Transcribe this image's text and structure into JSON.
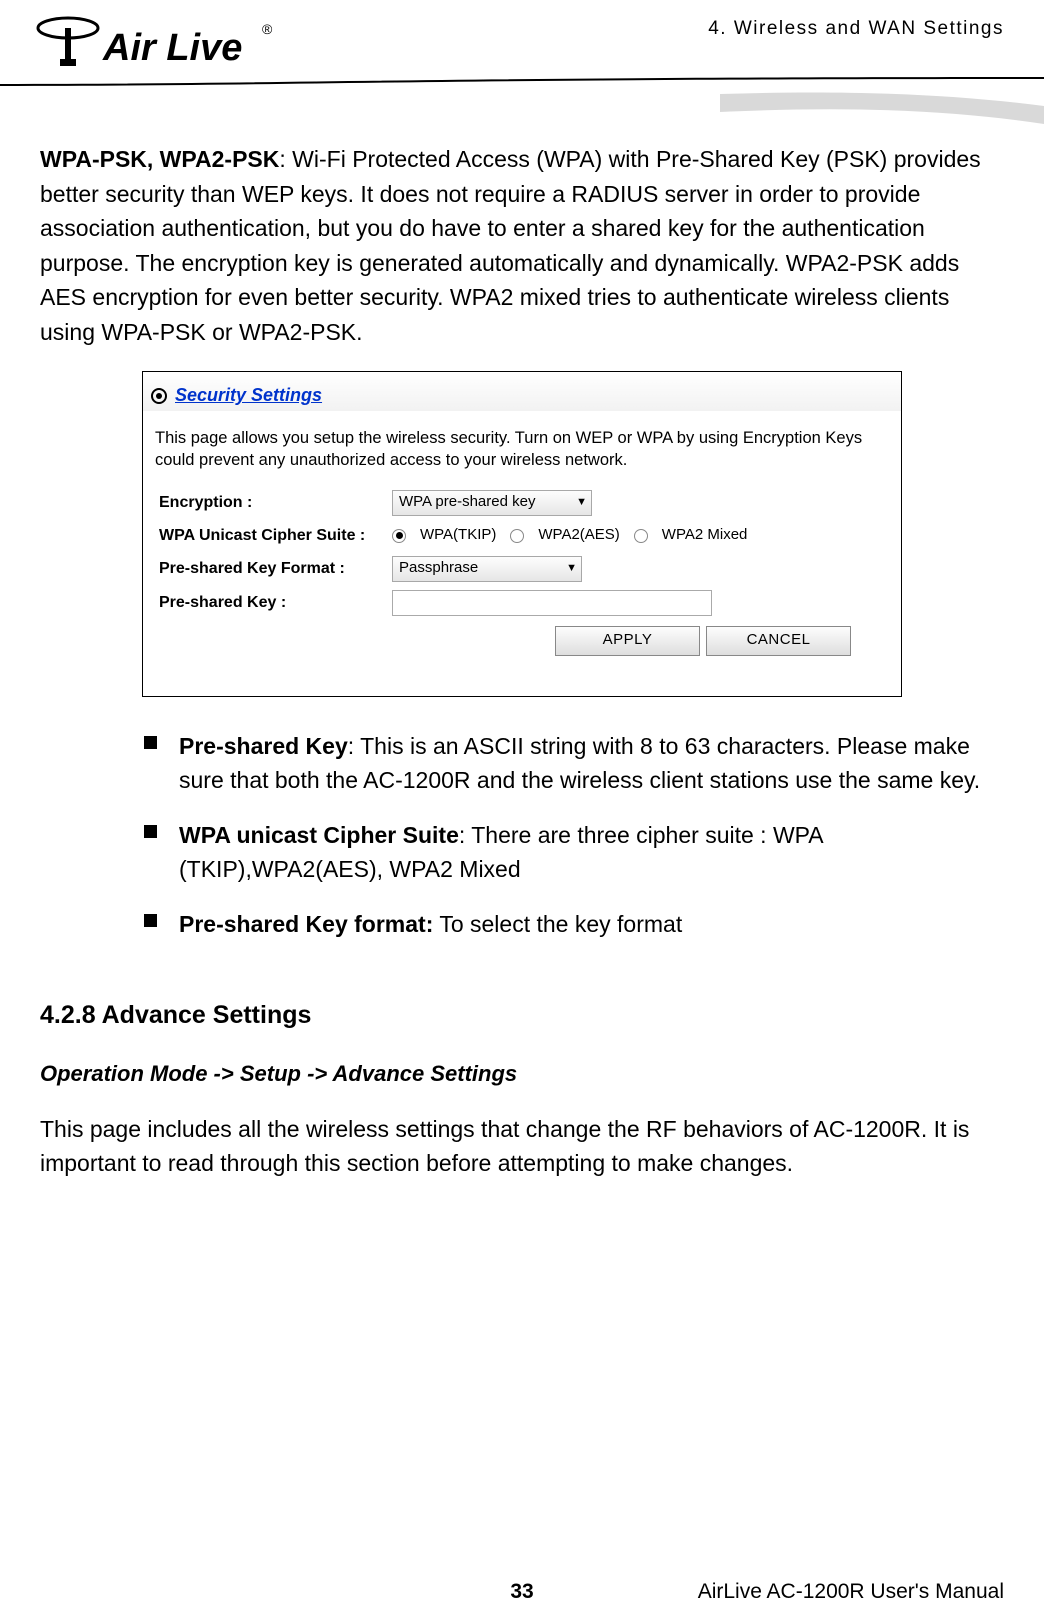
{
  "header": {
    "chapter_title": "4.  Wireless  and  WAN  Settings",
    "logo_text_top": "Air Live",
    "logo_mark": "®"
  },
  "intro": {
    "bold_lead": "WPA-PSK, WPA2-PSK",
    "text": ": Wi-Fi Protected Access (WPA) with Pre-Shared Key (PSK) provides better security than WEP keys. It does not require a RADIUS server in order to provide association authentication, but you do have to enter a shared key for the authentication purpose. The encryption key is generated automatically and dynamically. WPA2-PSK adds AES encryption for even better security. WPA2 mixed tries to authenticate wireless clients using WPA-PSK or WPA2-PSK."
  },
  "screenshot": {
    "title": "Security Settings",
    "description": "This page allows you setup the wireless security. Turn on WEP or WPA by using Encryption Keys could prevent any unauthorized access to your wireless network.",
    "labels": {
      "encryption": "Encryption :",
      "cipher": "WPA Unicast Cipher Suite :",
      "format": "Pre-shared Key Format :",
      "key": "Pre-shared Key :"
    },
    "encryption_value": "WPA pre-shared key",
    "cipher_options": {
      "tkip": "WPA(TKIP)",
      "aes": "WPA2(AES)",
      "mixed": "WPA2 Mixed"
    },
    "format_value": "Passphrase",
    "buttons": {
      "apply": "APPLY",
      "cancel": "CANCEL"
    }
  },
  "bullets": {
    "b1_bold": "Pre-shared Key",
    "b1_text": ": This is an ASCII string with 8 to 63 characters. Please make sure that both the AC-1200R and the wireless client stations use the same key.",
    "b2_bold": "WPA unicast Cipher Suite",
    "b2_text": ": There are three cipher suite : WPA (TKIP),WPA2(AES), WPA2 Mixed",
    "b3_bold": "Pre-shared Key format:",
    "b3_text": " To select the key format"
  },
  "section": {
    "heading": "4.2.8 Advance Settings",
    "breadcrumb": "Operation Mode -> Setup -> Advance Settings",
    "desc": "This page includes all the wireless settings that change the RF behaviors of AC-1200R. It is important to read through this section before attempting to make changes."
  },
  "footer": {
    "page": "33",
    "manual": "AirLive AC-1200R User's Manual"
  }
}
